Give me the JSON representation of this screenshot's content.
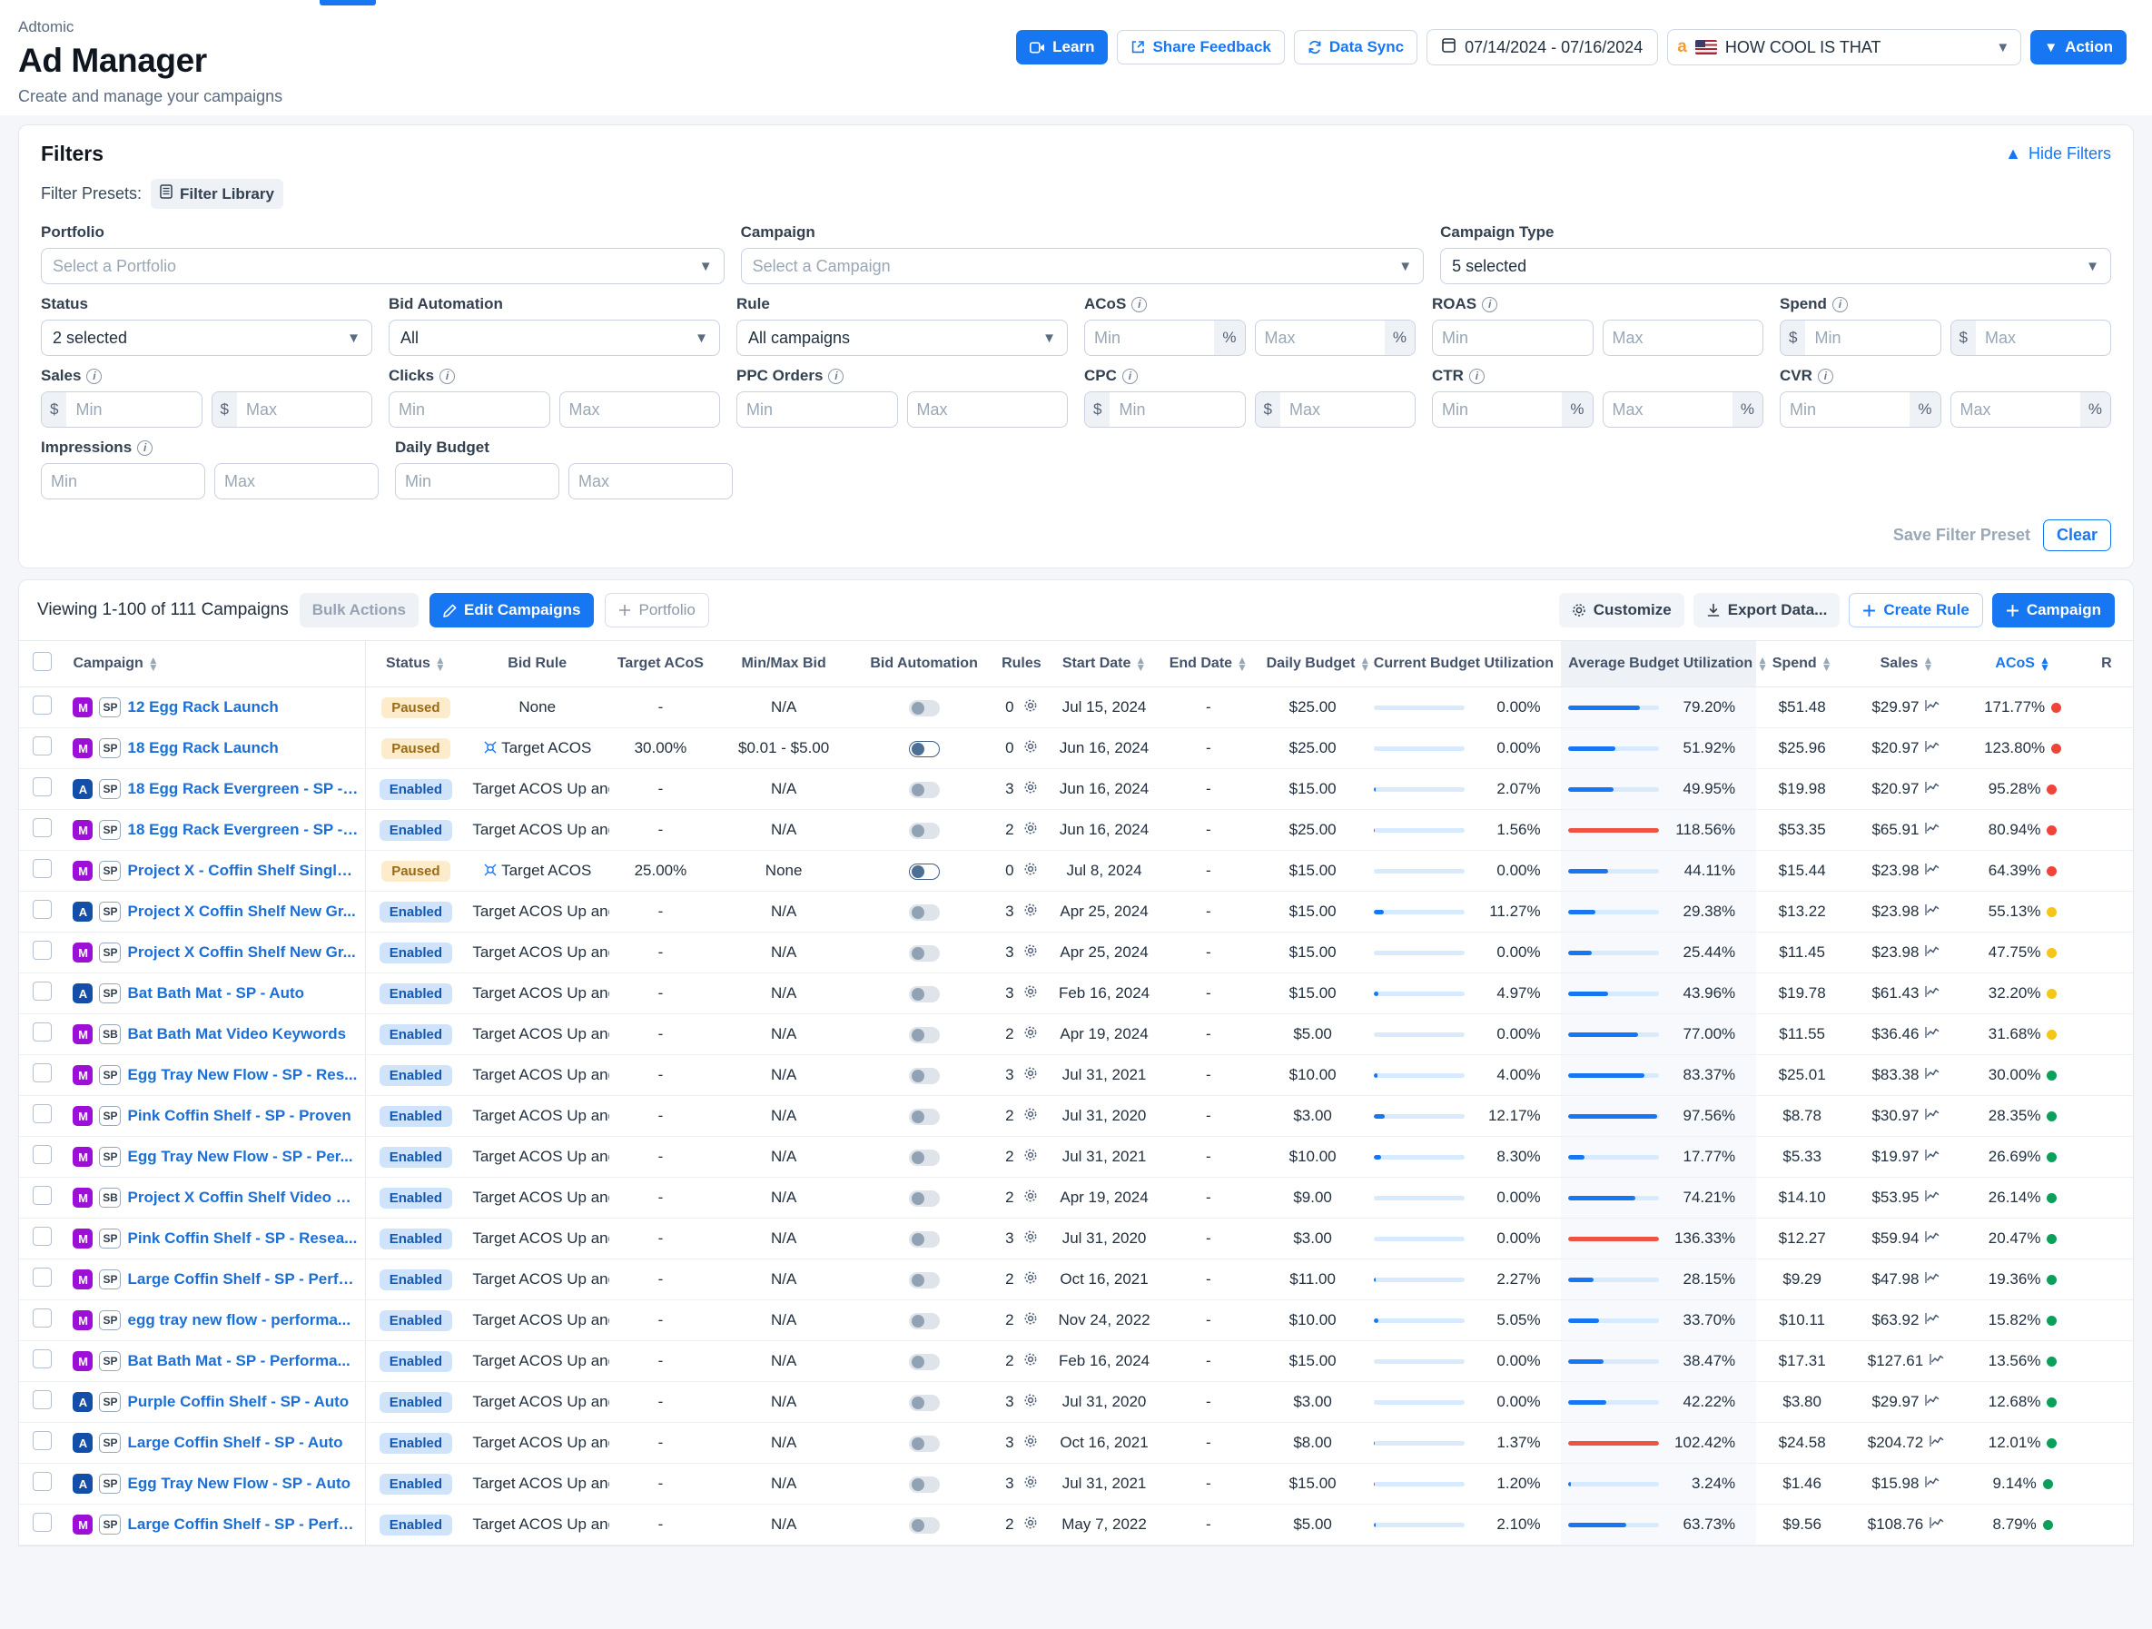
{
  "header": {
    "breadcrumb": "Adtomic",
    "title": "Ad Manager",
    "subtitle": "Create and manage your campaigns",
    "learn_label": "Learn",
    "share_feedback_label": "Share Feedback",
    "data_sync_label": "Data Sync",
    "date_range": "07/14/2024 - 07/16/2024",
    "account_name": "HOW COOL IS THAT",
    "action_label": "Action"
  },
  "filters": {
    "heading": "Filters",
    "hide_filters_label": "Hide Filters",
    "presets_label": "Filter Presets:",
    "filter_library_label": "Filter Library",
    "portfolio": {
      "label": "Portfolio",
      "value": "Select a Portfolio"
    },
    "campaign": {
      "label": "Campaign",
      "value": "Select a Campaign"
    },
    "campaign_type": {
      "label": "Campaign Type",
      "value": "5 selected"
    },
    "status": {
      "label": "Status",
      "value": "2 selected"
    },
    "bid_automation": {
      "label": "Bid Automation",
      "value": "All"
    },
    "rule": {
      "label": "Rule",
      "value": "All campaigns"
    },
    "acos": {
      "label": "ACoS",
      "min": "Min",
      "max": "Max",
      "unit": "%"
    },
    "roas": {
      "label": "ROAS",
      "min": "Min",
      "max": "Max"
    },
    "spend": {
      "label": "Spend",
      "min": "Min",
      "max": "Max",
      "unit": "$"
    },
    "sales": {
      "label": "Sales",
      "min": "Min",
      "max": "Max",
      "unit": "$"
    },
    "clicks": {
      "label": "Clicks",
      "min": "Min",
      "max": "Max"
    },
    "ppc_orders": {
      "label": "PPC Orders",
      "min": "Min",
      "max": "Max"
    },
    "cpc": {
      "label": "CPC",
      "min": "Min",
      "max": "Max",
      "unit": "$"
    },
    "ctr": {
      "label": "CTR",
      "min": "Min",
      "max": "Max",
      "unit": "%"
    },
    "cvr": {
      "label": "CVR",
      "min": "Min",
      "max": "Max",
      "unit": "%"
    },
    "impressions": {
      "label": "Impressions",
      "min": "Min",
      "max": "Max"
    },
    "daily_budget": {
      "label": "Daily Budget",
      "min": "Min",
      "max": "Max"
    },
    "save_preset_label": "Save Filter Preset",
    "clear_label": "Clear"
  },
  "toolbar": {
    "viewing": "Viewing 1-100 of 111 Campaigns",
    "bulk_actions_label": "Bulk Actions",
    "edit_campaigns_label": "Edit Campaigns",
    "portfolio_label": "Portfolio",
    "customize_label": "Customize",
    "export_label": "Export Data...",
    "create_rule_label": "Create Rule",
    "create_campaign_label": "Campaign"
  },
  "table": {
    "columns": [
      "Campaign",
      "Status",
      "Bid Rule",
      "Target ACoS",
      "Min/Max Bid",
      "Bid Automation",
      "Rules",
      "Start Date",
      "End Date",
      "Daily Budget",
      "Current Budget Utilization",
      "Average Budget Utilization",
      "Spend",
      "Sales",
      "ACoS",
      "R"
    ],
    "sorted_column": "ACoS",
    "rows": [
      {
        "acct": "M",
        "type": "SP",
        "name": "12 Egg Rack Launch",
        "status": "Paused",
        "bid_rule": "None",
        "bid_rule_icon": false,
        "target_acos": "-",
        "minmax": "N/A",
        "automation": false,
        "rules": "0",
        "start": "Jul 15, 2024",
        "end": "-",
        "budget": "$25.00",
        "cur_util": "0.00%",
        "cur_pct": 0,
        "avg_util": "79.20%",
        "avg_pct": 79.2,
        "spend": "$51.48",
        "sales": "$29.97",
        "acos": "171.77%",
        "acos_dot": "red"
      },
      {
        "acct": "M",
        "type": "SP",
        "name": "18 Egg Rack Launch",
        "status": "Paused",
        "bid_rule": "Target ACOS",
        "bid_rule_icon": true,
        "target_acos": "30.00%",
        "minmax": "$0.01 - $5.00",
        "automation": true,
        "rules": "0",
        "start": "Jun 16, 2024",
        "end": "-",
        "budget": "$25.00",
        "cur_util": "0.00%",
        "cur_pct": 0,
        "avg_util": "51.92%",
        "avg_pct": 51.92,
        "spend": "$25.96",
        "sales": "$20.97",
        "acos": "123.80%",
        "acos_dot": "red"
      },
      {
        "acct": "A",
        "type": "SP",
        "name": "18 Egg Rack Evergreen - SP - ...",
        "status": "Enabled",
        "bid_rule": "Target ACOS Up and D...",
        "bid_rule_icon": false,
        "target_acos": "-",
        "minmax": "N/A",
        "automation": false,
        "rules": "3",
        "start": "Jun 16, 2024",
        "end": "-",
        "budget": "$15.00",
        "cur_util": "2.07%",
        "cur_pct": 2.07,
        "avg_util": "49.95%",
        "avg_pct": 49.95,
        "spend": "$19.98",
        "sales": "$20.97",
        "acos": "95.28%",
        "acos_dot": "red"
      },
      {
        "acct": "M",
        "type": "SP",
        "name": "18 Egg Rack Evergreen - SP - ...",
        "status": "Enabled",
        "bid_rule": "Target ACOS Up and D...",
        "bid_rule_icon": false,
        "target_acos": "-",
        "minmax": "N/A",
        "automation": false,
        "rules": "2",
        "start": "Jun 16, 2024",
        "end": "-",
        "budget": "$25.00",
        "cur_util": "1.56%",
        "cur_pct": 1.56,
        "avg_util": "118.56%",
        "avg_pct": 100,
        "spend": "$53.35",
        "sales": "$65.91",
        "acos": "80.94%",
        "acos_dot": "red"
      },
      {
        "acct": "M",
        "type": "SP",
        "name": "Project X - Coffin Shelf Single ...",
        "status": "Paused",
        "bid_rule": "Target ACOS",
        "bid_rule_icon": true,
        "target_acos": "25.00%",
        "minmax": "None",
        "automation": true,
        "rules": "0",
        "start": "Jul 8, 2024",
        "end": "-",
        "budget": "$15.00",
        "cur_util": "0.00%",
        "cur_pct": 0,
        "avg_util": "44.11%",
        "avg_pct": 44.11,
        "spend": "$15.44",
        "sales": "$23.98",
        "acos": "64.39%",
        "acos_dot": "red"
      },
      {
        "acct": "A",
        "type": "SP",
        "name": "Project X Coffin Shelf New Gr...",
        "status": "Enabled",
        "bid_rule": "Target ACOS Up and D...",
        "bid_rule_icon": false,
        "target_acos": "-",
        "minmax": "N/A",
        "automation": false,
        "rules": "3",
        "start": "Apr 25, 2024",
        "end": "-",
        "budget": "$15.00",
        "cur_util": "11.27%",
        "cur_pct": 11.27,
        "avg_util": "29.38%",
        "avg_pct": 29.38,
        "spend": "$13.22",
        "sales": "$23.98",
        "acos": "55.13%",
        "acos_dot": "yellow"
      },
      {
        "acct": "M",
        "type": "SP",
        "name": "Project X Coffin Shelf New Gr...",
        "status": "Enabled",
        "bid_rule": "Target ACOS Up and D...",
        "bid_rule_icon": false,
        "target_acos": "-",
        "minmax": "N/A",
        "automation": false,
        "rules": "3",
        "start": "Apr 25, 2024",
        "end": "-",
        "budget": "$15.00",
        "cur_util": "0.00%",
        "cur_pct": 0,
        "avg_util": "25.44%",
        "avg_pct": 25.44,
        "spend": "$11.45",
        "sales": "$23.98",
        "acos": "47.75%",
        "acos_dot": "yellow"
      },
      {
        "acct": "A",
        "type": "SP",
        "name": "Bat Bath Mat - SP - Auto",
        "status": "Enabled",
        "bid_rule": "Target ACOS Up and D...",
        "bid_rule_icon": false,
        "target_acos": "-",
        "minmax": "N/A",
        "automation": false,
        "rules": "3",
        "start": "Feb 16, 2024",
        "end": "-",
        "budget": "$15.00",
        "cur_util": "4.97%",
        "cur_pct": 4.97,
        "avg_util": "43.96%",
        "avg_pct": 43.96,
        "spend": "$19.78",
        "sales": "$61.43",
        "acos": "32.20%",
        "acos_dot": "yellow"
      },
      {
        "acct": "M",
        "type": "SB",
        "name": "Bat Bath Mat Video Keywords",
        "status": "Enabled",
        "bid_rule": "Target ACOS Up and D...",
        "bid_rule_icon": false,
        "target_acos": "-",
        "minmax": "N/A",
        "automation": false,
        "rules": "2",
        "start": "Apr 19, 2024",
        "end": "-",
        "budget": "$5.00",
        "cur_util": "0.00%",
        "cur_pct": 0,
        "avg_util": "77.00%",
        "avg_pct": 77,
        "spend": "$11.55",
        "sales": "$36.46",
        "acos": "31.68%",
        "acos_dot": "yellow"
      },
      {
        "acct": "M",
        "type": "SP",
        "name": "Egg Tray New Flow - SP - Res...",
        "status": "Enabled",
        "bid_rule": "Target ACOS Up and D...",
        "bid_rule_icon": false,
        "target_acos": "-",
        "minmax": "N/A",
        "automation": false,
        "rules": "3",
        "start": "Jul 31, 2021",
        "end": "-",
        "budget": "$10.00",
        "cur_util": "4.00%",
        "cur_pct": 4,
        "avg_util": "83.37%",
        "avg_pct": 83.37,
        "spend": "$25.01",
        "sales": "$83.38",
        "acos": "30.00%",
        "acos_dot": "green"
      },
      {
        "acct": "M",
        "type": "SP",
        "name": "Pink Coffin Shelf - SP - Proven",
        "status": "Enabled",
        "bid_rule": "Target ACOS Up and D...",
        "bid_rule_icon": false,
        "target_acos": "-",
        "minmax": "N/A",
        "automation": false,
        "rules": "2",
        "start": "Jul 31, 2020",
        "end": "-",
        "budget": "$3.00",
        "cur_util": "12.17%",
        "cur_pct": 12.17,
        "avg_util": "97.56%",
        "avg_pct": 97.56,
        "spend": "$8.78",
        "sales": "$30.97",
        "acos": "28.35%",
        "acos_dot": "green"
      },
      {
        "acct": "M",
        "type": "SP",
        "name": "Egg Tray New Flow - SP - Per...",
        "status": "Enabled",
        "bid_rule": "Target ACOS Up and D...",
        "bid_rule_icon": false,
        "target_acos": "-",
        "minmax": "N/A",
        "automation": false,
        "rules": "2",
        "start": "Jul 31, 2021",
        "end": "-",
        "budget": "$10.00",
        "cur_util": "8.30%",
        "cur_pct": 8.3,
        "avg_util": "17.77%",
        "avg_pct": 17.77,
        "spend": "$5.33",
        "sales": "$19.97",
        "acos": "26.69%",
        "acos_dot": "green"
      },
      {
        "acct": "M",
        "type": "SB",
        "name": "Project X Coffin Shelf Video K...",
        "status": "Enabled",
        "bid_rule": "Target ACOS Up and D...",
        "bid_rule_icon": false,
        "target_acos": "-",
        "minmax": "N/A",
        "automation": false,
        "rules": "2",
        "start": "Apr 19, 2024",
        "end": "-",
        "budget": "$9.00",
        "cur_util": "0.00%",
        "cur_pct": 0,
        "avg_util": "74.21%",
        "avg_pct": 74.21,
        "spend": "$14.10",
        "sales": "$53.95",
        "acos": "26.14%",
        "acos_dot": "green"
      },
      {
        "acct": "M",
        "type": "SP",
        "name": "Pink Coffin Shelf - SP - Resea...",
        "status": "Enabled",
        "bid_rule": "Target ACOS Up and D...",
        "bid_rule_icon": false,
        "target_acos": "-",
        "minmax": "N/A",
        "automation": false,
        "rules": "3",
        "start": "Jul 31, 2020",
        "end": "-",
        "budget": "$3.00",
        "cur_util": "0.00%",
        "cur_pct": 0,
        "avg_util": "136.33%",
        "avg_pct": 100,
        "spend": "$12.27",
        "sales": "$59.94",
        "acos": "20.47%",
        "acos_dot": "green"
      },
      {
        "acct": "M",
        "type": "SP",
        "name": "Large Coffin Shelf - SP - Perfo...",
        "status": "Enabled",
        "bid_rule": "Target ACOS Up and D...",
        "bid_rule_icon": false,
        "target_acos": "-",
        "minmax": "N/A",
        "automation": false,
        "rules": "2",
        "start": "Oct 16, 2021",
        "end": "-",
        "budget": "$11.00",
        "cur_util": "2.27%",
        "cur_pct": 2.27,
        "avg_util": "28.15%",
        "avg_pct": 28.15,
        "spend": "$9.29",
        "sales": "$47.98",
        "acos": "19.36%",
        "acos_dot": "green"
      },
      {
        "acct": "M",
        "type": "SP",
        "name": "egg tray new flow - performa...",
        "status": "Enabled",
        "bid_rule": "Target ACOS Up and D...",
        "bid_rule_icon": false,
        "target_acos": "-",
        "minmax": "N/A",
        "automation": false,
        "rules": "2",
        "start": "Nov 24, 2022",
        "end": "-",
        "budget": "$10.00",
        "cur_util": "5.05%",
        "cur_pct": 5.05,
        "avg_util": "33.70%",
        "avg_pct": 33.7,
        "spend": "$10.11",
        "sales": "$63.92",
        "acos": "15.82%",
        "acos_dot": "green"
      },
      {
        "acct": "M",
        "type": "SP",
        "name": "Bat Bath Mat - SP - Performa...",
        "status": "Enabled",
        "bid_rule": "Target ACOS Up and D...",
        "bid_rule_icon": false,
        "target_acos": "-",
        "minmax": "N/A",
        "automation": false,
        "rules": "2",
        "start": "Feb 16, 2024",
        "end": "-",
        "budget": "$15.00",
        "cur_util": "0.00%",
        "cur_pct": 0,
        "avg_util": "38.47%",
        "avg_pct": 38.47,
        "spend": "$17.31",
        "sales": "$127.61",
        "acos": "13.56%",
        "acos_dot": "green"
      },
      {
        "acct": "A",
        "type": "SP",
        "name": "Purple Coffin Shelf - SP - Auto",
        "status": "Enabled",
        "bid_rule": "Target ACOS Up and D...",
        "bid_rule_icon": false,
        "target_acos": "-",
        "minmax": "N/A",
        "automation": false,
        "rules": "3",
        "start": "Jul 31, 2020",
        "end": "-",
        "budget": "$3.00",
        "cur_util": "0.00%",
        "cur_pct": 0,
        "avg_util": "42.22%",
        "avg_pct": 42.22,
        "spend": "$3.80",
        "sales": "$29.97",
        "acos": "12.68%",
        "acos_dot": "green"
      },
      {
        "acct": "A",
        "type": "SP",
        "name": "Large Coffin Shelf - SP - Auto",
        "status": "Enabled",
        "bid_rule": "Target ACOS Up and D...",
        "bid_rule_icon": false,
        "target_acos": "-",
        "minmax": "N/A",
        "automation": false,
        "rules": "3",
        "start": "Oct 16, 2021",
        "end": "-",
        "budget": "$8.00",
        "cur_util": "1.37%",
        "cur_pct": 1.37,
        "avg_util": "102.42%",
        "avg_pct": 100,
        "spend": "$24.58",
        "sales": "$204.72",
        "acos": "12.01%",
        "acos_dot": "green"
      },
      {
        "acct": "A",
        "type": "SP",
        "name": "Egg Tray New Flow - SP - Auto",
        "status": "Enabled",
        "bid_rule": "Target ACOS Up and D...",
        "bid_rule_icon": false,
        "target_acos": "-",
        "minmax": "N/A",
        "automation": false,
        "rules": "3",
        "start": "Jul 31, 2021",
        "end": "-",
        "budget": "$15.00",
        "cur_util": "1.20%",
        "cur_pct": 1.2,
        "avg_util": "3.24%",
        "avg_pct": 3.24,
        "spend": "$1.46",
        "sales": "$15.98",
        "acos": "9.14%",
        "acos_dot": "green"
      },
      {
        "acct": "M",
        "type": "SP",
        "name": "Large Coffin Shelf - SP - Perfo...",
        "status": "Enabled",
        "bid_rule": "Target ACOS Up and D...",
        "bid_rule_icon": false,
        "target_acos": "-",
        "minmax": "N/A",
        "automation": false,
        "rules": "2",
        "start": "May 7, 2022",
        "end": "-",
        "budget": "$5.00",
        "cur_util": "2.10%",
        "cur_pct": 2.1,
        "avg_util": "63.73%",
        "avg_pct": 63.73,
        "spend": "$9.56",
        "sales": "$108.76",
        "acos": "8.79%",
        "acos_dot": "green"
      }
    ]
  },
  "colors": {
    "accent": "#1777f2",
    "over_budget": "#ef5344",
    "good": "#0aa05a",
    "warn": "#f5c518",
    "bad": "#f04438"
  }
}
